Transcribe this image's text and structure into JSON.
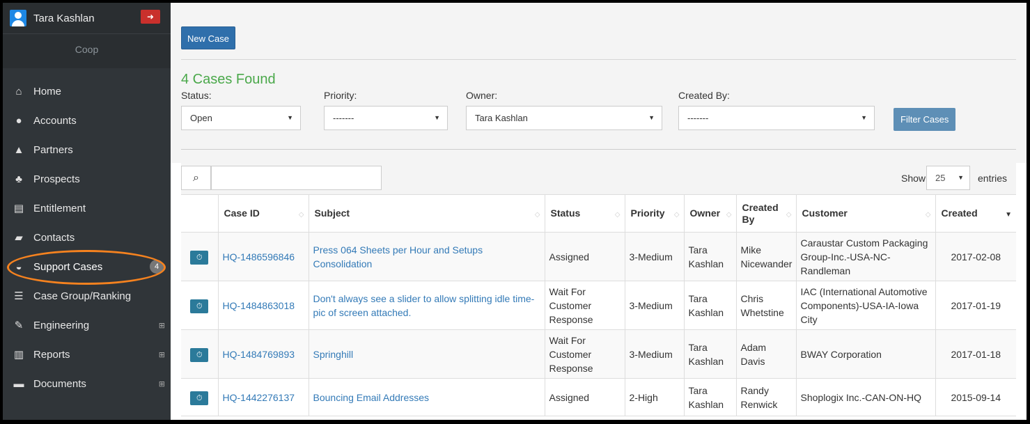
{
  "user": {
    "name": "Tara Kashlan",
    "org": "Coop",
    "logout_icon": "sign-out-icon"
  },
  "nav": [
    {
      "label": "Home",
      "icon": "home-icon",
      "glyph": "⌂"
    },
    {
      "label": "Accounts",
      "icon": "globe-icon",
      "glyph": "●"
    },
    {
      "label": "Partners",
      "icon": "thumbs-up-icon",
      "glyph": "▲"
    },
    {
      "label": "Prospects",
      "icon": "bell-icon",
      "glyph": "♣"
    },
    {
      "label": "Entitlement",
      "icon": "file-icon",
      "glyph": "▤"
    },
    {
      "label": "Contacts",
      "icon": "book-icon",
      "glyph": "▰"
    },
    {
      "label": "Support Cases",
      "icon": "inbox-icon",
      "glyph": "◒",
      "badge": "4"
    },
    {
      "label": "Case Group/Ranking",
      "icon": "list-icon",
      "glyph": "☰"
    },
    {
      "label": "Engineering",
      "icon": "wrench-icon",
      "glyph": "✎",
      "expand": "⊞"
    },
    {
      "label": "Reports",
      "icon": "bar-chart-icon",
      "glyph": "▥",
      "expand": "⊞"
    },
    {
      "label": "Documents",
      "icon": "briefcase-icon",
      "glyph": "▬",
      "expand": "⊞"
    }
  ],
  "toolbar": {
    "new_case": "New Case"
  },
  "results": {
    "found": "4 Cases Found"
  },
  "filters": {
    "status": {
      "label": "Status:",
      "value": "Open"
    },
    "priority": {
      "label": "Priority:",
      "value": "-------"
    },
    "owner": {
      "label": "Owner:",
      "value": "Tara Kashlan"
    },
    "created_by": {
      "label": "Created By:",
      "value": "-------"
    },
    "filter_button": "Filter Cases"
  },
  "table_controls": {
    "show": "Show",
    "entries_value": "25",
    "entries": "entries",
    "search_placeholder": ""
  },
  "columns": [
    "",
    "Case ID",
    "Subject",
    "Status",
    "Priority",
    "Owner",
    "Created By",
    "Customer",
    "Created"
  ],
  "rows": [
    {
      "case_id": "HQ-1486596846",
      "subject": "Press 064 Sheets per Hour and Setups Consolidation",
      "status": "Assigned",
      "priority": "3-Medium",
      "owner": "Tara Kashlan",
      "created_by": "Mike Nicewander",
      "customer": "Caraustar Custom Packaging Group-Inc.-USA-NC-Randleman",
      "created": "2017-02-08"
    },
    {
      "case_id": "HQ-1484863018",
      "subject": "Don't always see a slider to allow splitting idle time- pic of screen attached.",
      "status": "Wait For Customer Response",
      "priority": "3-Medium",
      "owner": "Tara Kashlan",
      "created_by": "Chris Whetstine",
      "customer": "IAC (International Automotive Components)-USA-IA-Iowa City",
      "created": "2017-01-19"
    },
    {
      "case_id": "HQ-1484769893",
      "subject": "Springhill",
      "status": "Wait For Customer Response",
      "priority": "3-Medium",
      "owner": "Tara Kashlan",
      "created_by": "Adam Davis",
      "customer": "BWAY Corporation",
      "created": "2017-01-18"
    },
    {
      "case_id": "HQ-1442276137",
      "subject": "Bouncing Email Addresses",
      "status": "Assigned",
      "priority": "2-High",
      "owner": "Tara Kashlan",
      "created_by": "Randy Renwick",
      "customer": "Shoplogix Inc.-CAN-ON-HQ",
      "created": "2015-09-14"
    }
  ],
  "colors": {
    "sidebar": "#303539",
    "accent": "#2f6fab",
    "success": "#4aa84a",
    "highlight": "#f5821f"
  }
}
